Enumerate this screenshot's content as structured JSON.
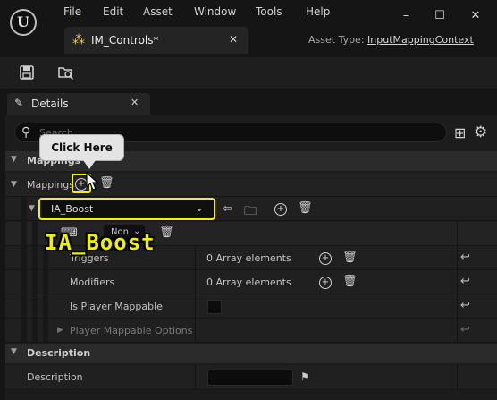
{
  "app": {
    "logo": "U",
    "menu": [
      "File",
      "Edit",
      "Asset",
      "Window",
      "Tools",
      "Help"
    ],
    "window_controls": {
      "minimize": "–",
      "maximize": "☐",
      "close": "✕"
    }
  },
  "asset_tab": {
    "label": "IM_Controls*",
    "icon": "input-mapping-icon",
    "close": "✕"
  },
  "asset_type": {
    "prefix": "Asset Type:",
    "link": "InputMappingContext"
  },
  "toolbar": {
    "save_icon": "save-icon",
    "browse_icon": "browse-icon"
  },
  "details_tab": {
    "label": "Details",
    "close": "✕"
  },
  "search": {
    "placeholder": "Search"
  },
  "sections": {
    "mappings_category": "Mappings",
    "mappings_row": "Mappings",
    "description_category": "Description"
  },
  "mapping_entry": {
    "action": "IA_Boost",
    "key_value": "Non"
  },
  "properties": [
    {
      "label": "Triggers",
      "value": "0 Array elements"
    },
    {
      "label": "Modifiers",
      "value": "0 Array elements"
    },
    {
      "label": "Is Player Mappable",
      "value": ""
    },
    {
      "label": "Player Mappable Options",
      "value": ""
    }
  ],
  "description": {
    "label": "Description",
    "value": ""
  },
  "annotations": {
    "callout": "Click Here",
    "big_label": "IA_Boost"
  },
  "colors": {
    "highlight": "#f2f200",
    "asset_icon": "#e8c84a"
  }
}
